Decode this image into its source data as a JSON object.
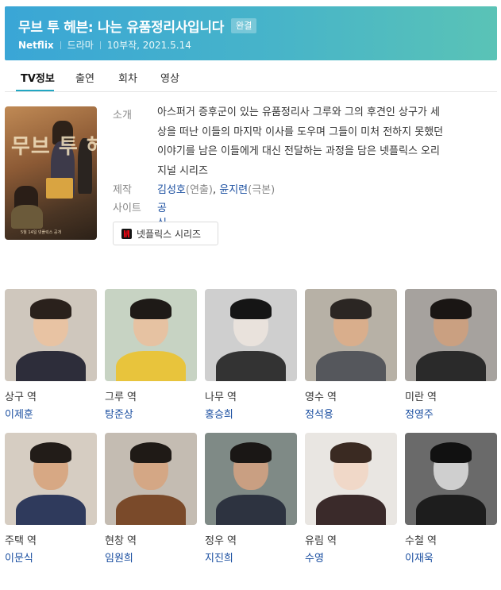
{
  "header": {
    "title": "무브 투 헤븐: 나는 유품정리사입니다",
    "badge": "완결",
    "network": "Netflix",
    "genre": "드라마",
    "episodes_date": "10부작, 2021.5.14"
  },
  "tabs": [
    {
      "label": "TV정보",
      "active": true
    },
    {
      "label": "출연",
      "active": false
    },
    {
      "label": "회차",
      "active": false
    },
    {
      "label": "영상",
      "active": false
    }
  ],
  "poster": {
    "title_text": "무브 투 헤븐",
    "sub_text": "5월 14일 넷플릭스 공개"
  },
  "info": {
    "synopsis_label": "소개",
    "synopsis_lines": [
      "아스퍼거 증후군이 있는 유품정리사 그루와 그의 후견인 상구가 세",
      "상을 떠난 이들의 마지막 이사를 도우며 그들이 미처 전하지 못했던",
      "이야기를 남은 이들에게 대신 전달하는 과정을 담은 넷플릭스 오리",
      "지널 시리즈"
    ],
    "production_label": "제작",
    "director_name": "김성호",
    "director_role": "(연출)",
    "comma": ",",
    "writer_name": "윤지련",
    "writer_role": "(극본)",
    "site_label": "사이트",
    "site_link": "공식홈"
  },
  "netflix_button": {
    "label": "넷플릭스 시리즈",
    "icon": "netflix-icon"
  },
  "colors": {
    "header_gradient_start": "#3aa6d6",
    "header_gradient_end": "#5ac3b6",
    "link": "#1a4ea0",
    "tab_accent": "#22a7c3"
  },
  "cast": [
    {
      "role": "상구 역",
      "actor": "이제훈",
      "bg": "#cfc7bd",
      "skin": "#e8c3a3",
      "hair": "#2a211c",
      "cloth": "#2d2d3a"
    },
    {
      "role": "그루 역",
      "actor": "탕준상",
      "bg": "#c7d3c3",
      "skin": "#e6c2a2",
      "hair": "#1e1a17",
      "cloth": "#e8c43c"
    },
    {
      "role": "나무 역",
      "actor": "홍승희",
      "bg": "#cfcfcf",
      "skin": "#e9e2dc",
      "hair": "#151515",
      "cloth": "#333333"
    },
    {
      "role": "영수 역",
      "actor": "정석용",
      "bg": "#b7b1a6",
      "skin": "#d9ae8c",
      "hair": "#2b2623",
      "cloth": "#55575c"
    },
    {
      "role": "미란 역",
      "actor": "정영주",
      "bg": "#a6a29e",
      "skin": "#caa081",
      "hair": "#1a1614",
      "cloth": "#2a2a2a"
    },
    {
      "role": "주택 역",
      "actor": "이문식",
      "bg": "#d6cdc2",
      "skin": "#d7a884",
      "hair": "#221c18",
      "cloth": "#2f3a5c"
    },
    {
      "role": "현창 역",
      "actor": "임원희",
      "bg": "#c4bcb2",
      "skin": "#d4a785",
      "hair": "#1f1a16",
      "cloth": "#7a4a2a"
    },
    {
      "role": "정우 역",
      "actor": "지진희",
      "bg": "#7f8a86",
      "skin": "#c99f82",
      "hair": "#1a1715",
      "cloth": "#2d3340"
    },
    {
      "role": "유림 역",
      "actor": "수영",
      "bg": "#e9e6e2",
      "skin": "#f0d8c8",
      "hair": "#3a2a22",
      "cloth": "#3a2a2a"
    },
    {
      "role": "수철 역",
      "actor": "이재욱",
      "bg": "#6a6a6a",
      "skin": "#cfcfcf",
      "hair": "#111111",
      "cloth": "#1d1d1d"
    }
  ]
}
